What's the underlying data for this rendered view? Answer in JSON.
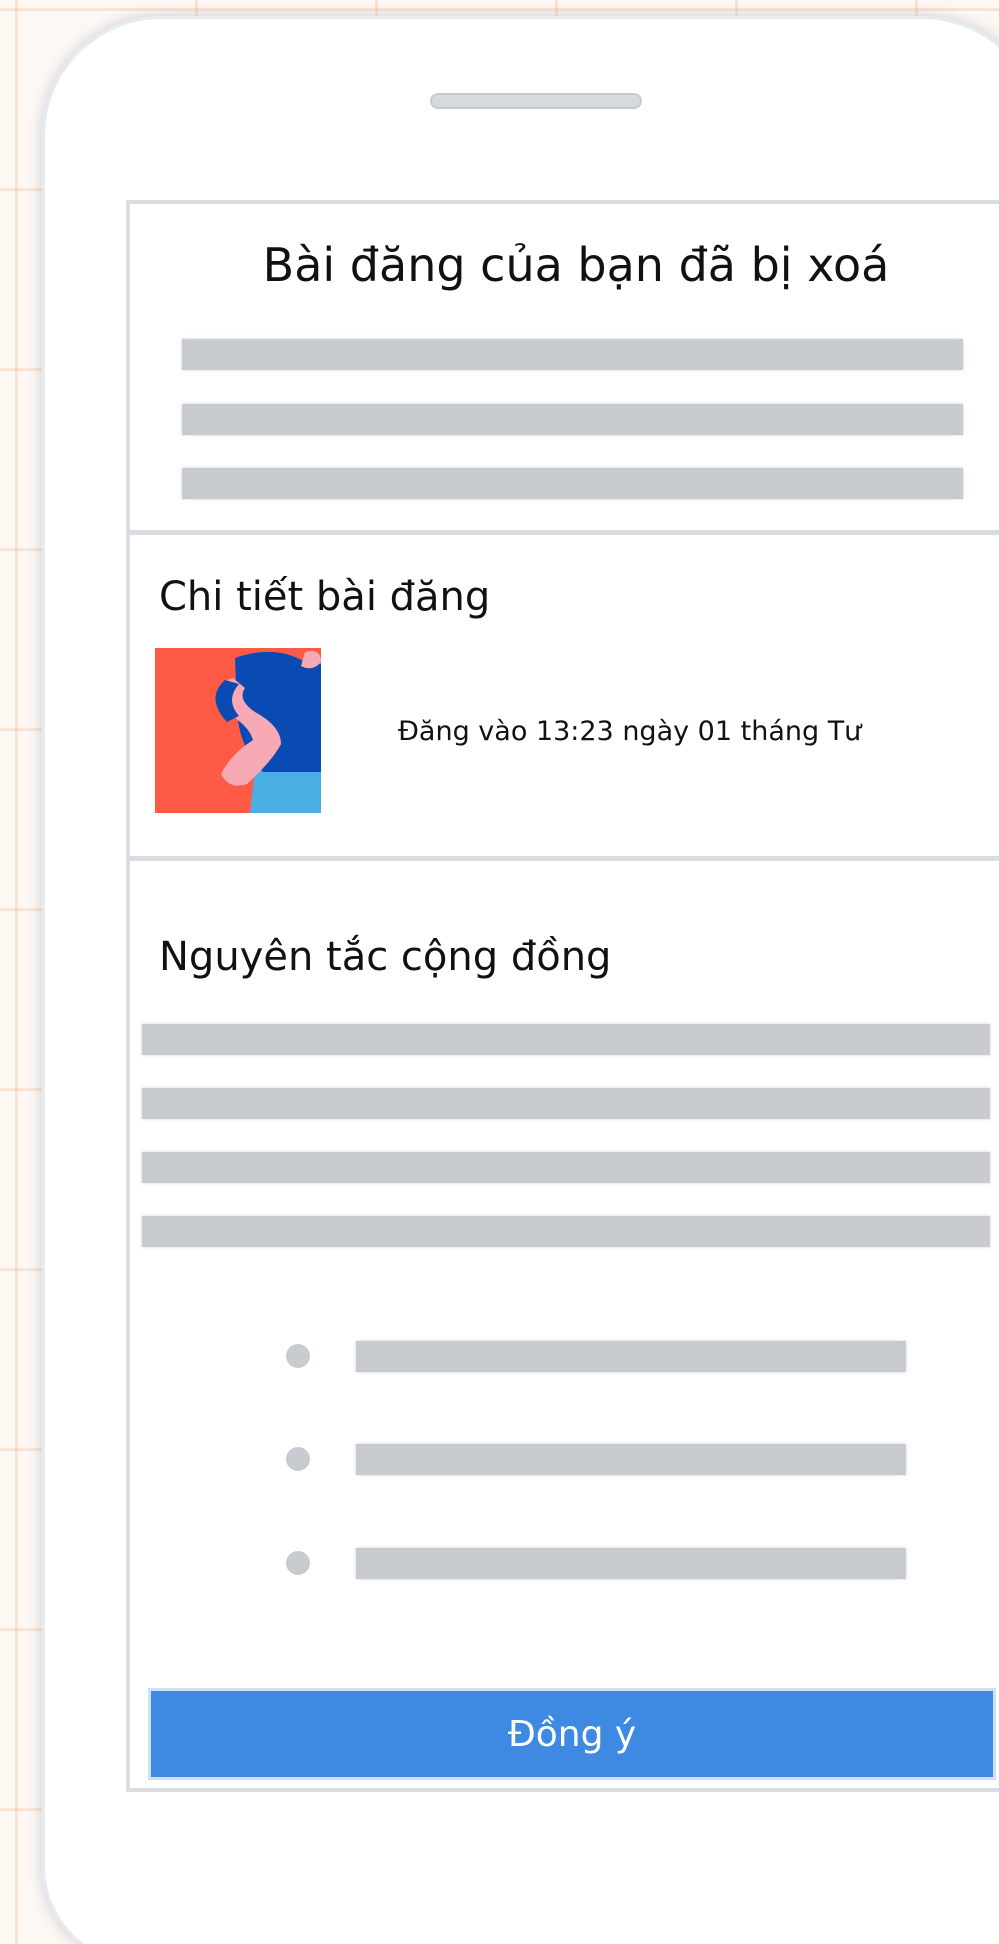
{
  "dialog": {
    "title": "Bài đăng của bạn đã bị xoá"
  },
  "post_details": {
    "heading": "Chi tiết bài đăng",
    "posted_at": "Đăng vào 13:23 ngày 01 tháng Tư",
    "thumbnail_icon": "person-illustration-icon"
  },
  "guidelines": {
    "heading": "Nguyên tắc cộng đồng"
  },
  "actions": {
    "agree_label": "Đồng ý"
  },
  "colors": {
    "accent": "#3e89e2",
    "placeholder": "#c8cbd0",
    "thumbnail_bg": "#ff5a45",
    "thumbnail_shirt": "#0a4ab3",
    "thumbnail_pants": "#4aaee3",
    "thumbnail_skin": "#f7a9b4"
  }
}
